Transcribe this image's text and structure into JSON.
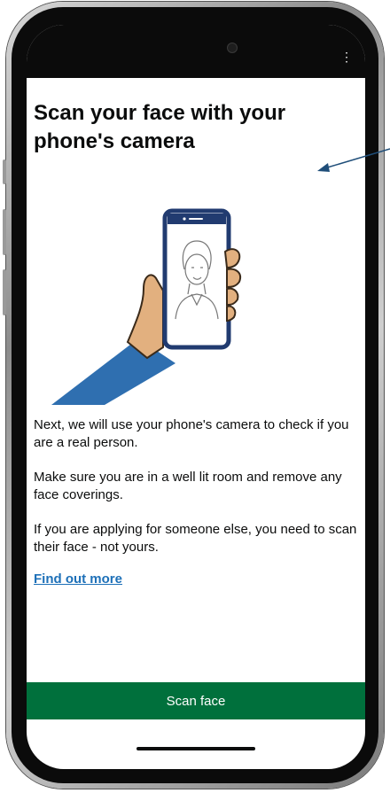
{
  "screen": {
    "title": "Scan your face with your phone's camera",
    "paragraphs": [
      "Next, we will use your phone's camera to check if you are a real person.",
      "Make sure you are in a well lit room and remove any face coverings.",
      "If you are applying for someone else, you need to scan their face - not yours."
    ],
    "link_label": "Find out more",
    "button_label": "Scan face"
  },
  "status_bar": {
    "menu_icon": "vertical-dots-icon"
  },
  "colors": {
    "button_green": "#00703c",
    "link_blue": "#1d70b8",
    "text": "#0b0c0c",
    "sleeve_blue": "#2f6fb0",
    "skin": "#e2b07f",
    "arrow": "#1f4e79"
  }
}
